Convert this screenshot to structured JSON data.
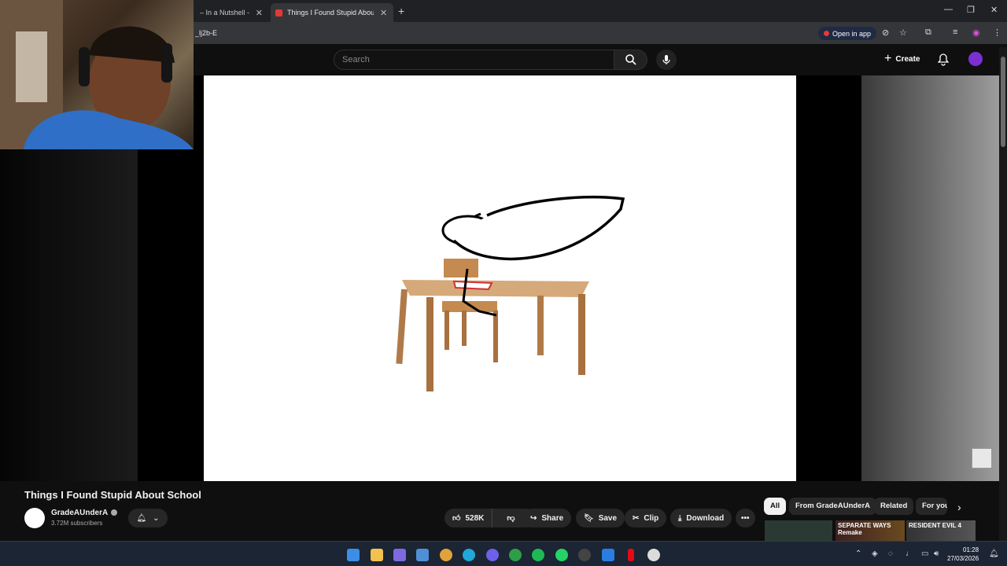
{
  "browser": {
    "tabs": [
      {
        "label": "– In a Nutshell - You"
      },
      {
        "label": "Things I Found Stupid About S"
      }
    ],
    "url_fragment": "_lj2b-E",
    "open_in_app": "Open in app"
  },
  "youtube": {
    "search_placeholder": "Search",
    "create_label": "Create"
  },
  "video": {
    "title": "Things I Found Stupid About School",
    "channel": "GradeAUnderA",
    "subscribers": "3.72M subscribers",
    "likes": "528K",
    "actions": {
      "share": "Share",
      "save": "Save",
      "clip": "Clip",
      "download": "Download"
    }
  },
  "filters": [
    "All",
    "From GradeAUnderA",
    "Related",
    "For you"
  ],
  "recommended_thumbs": [
    {
      "text": "SEPARATE WAYS Remake"
    },
    {
      "text": "RESIDENT EVIL 4"
    }
  ],
  "taskbar": {
    "time": "01:28",
    "date": "27/03/2026"
  },
  "colors": {
    "accent_red": "#e53935",
    "youtube_bg": "#0f0f0f",
    "taskbar": "#1c2533"
  }
}
